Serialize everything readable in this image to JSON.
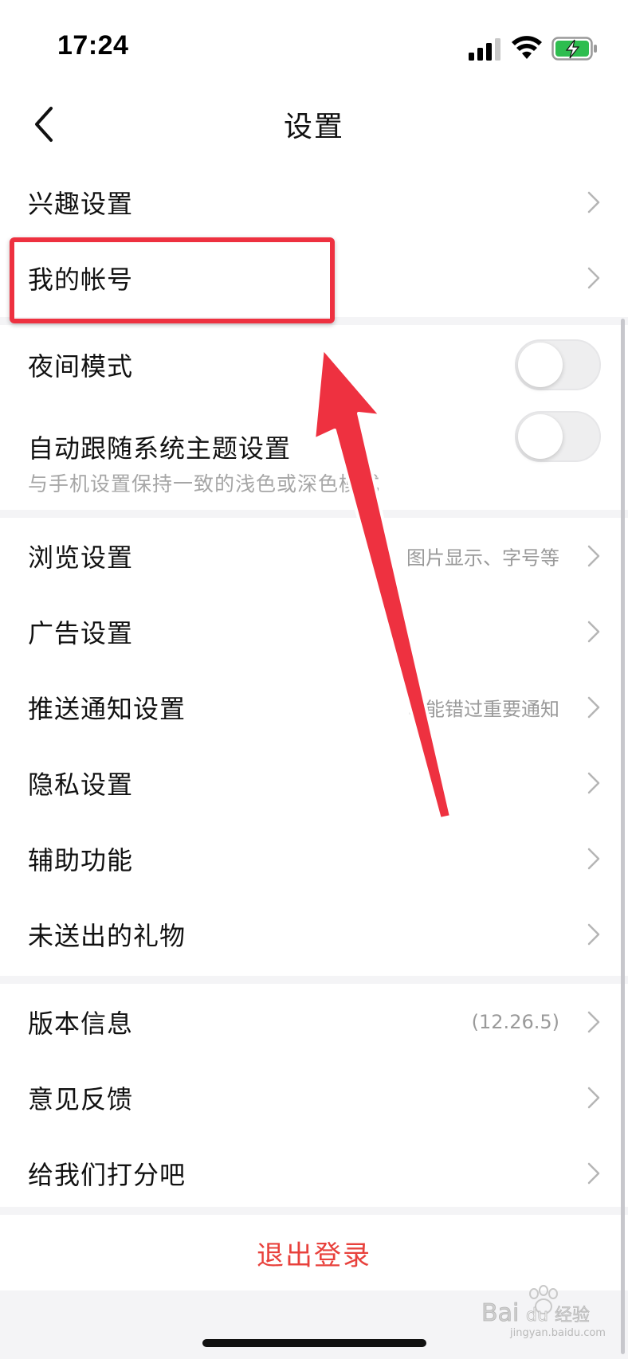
{
  "status_bar": {
    "time": "17:24",
    "icons": [
      "signal-icon",
      "wifi-icon",
      "battery-charging-icon"
    ],
    "battery_color": "#2ebd4f"
  },
  "nav": {
    "title": "设置",
    "back_icon": "chevron-left-icon"
  },
  "sections": {
    "interest": {
      "label": "兴趣设置"
    },
    "account": {
      "label": "我的帐号"
    },
    "night_mode": {
      "label": "夜间模式",
      "enabled": false
    },
    "auto_theme": {
      "label": "自动跟随系统主题设置",
      "sublabel": "与手机设置保持一致的浅色或深色模式",
      "enabled": false
    },
    "browse": {
      "label": "浏览设置",
      "value": "图片显示、字号等"
    },
    "ads": {
      "label": "广告设置"
    },
    "push": {
      "label": "推送通知设置",
      "value": "可能错过重要通知"
    },
    "privacy": {
      "label": "隐私设置"
    },
    "accessibility": {
      "label": "辅助功能"
    },
    "gifts": {
      "label": "未送出的礼物"
    },
    "version": {
      "label": "版本信息",
      "value": "(12.26.5)"
    },
    "feedback": {
      "label": "意见反馈"
    },
    "rate": {
      "label": "给我们打分吧"
    }
  },
  "logout": {
    "label": "退出登录"
  },
  "colors": {
    "accent": "#e8413c",
    "highlight": "#ee3140",
    "background": "#f4f4f6"
  },
  "watermark": {
    "brand": "Baidu经验",
    "domain": "jingyan.baidu.com"
  }
}
